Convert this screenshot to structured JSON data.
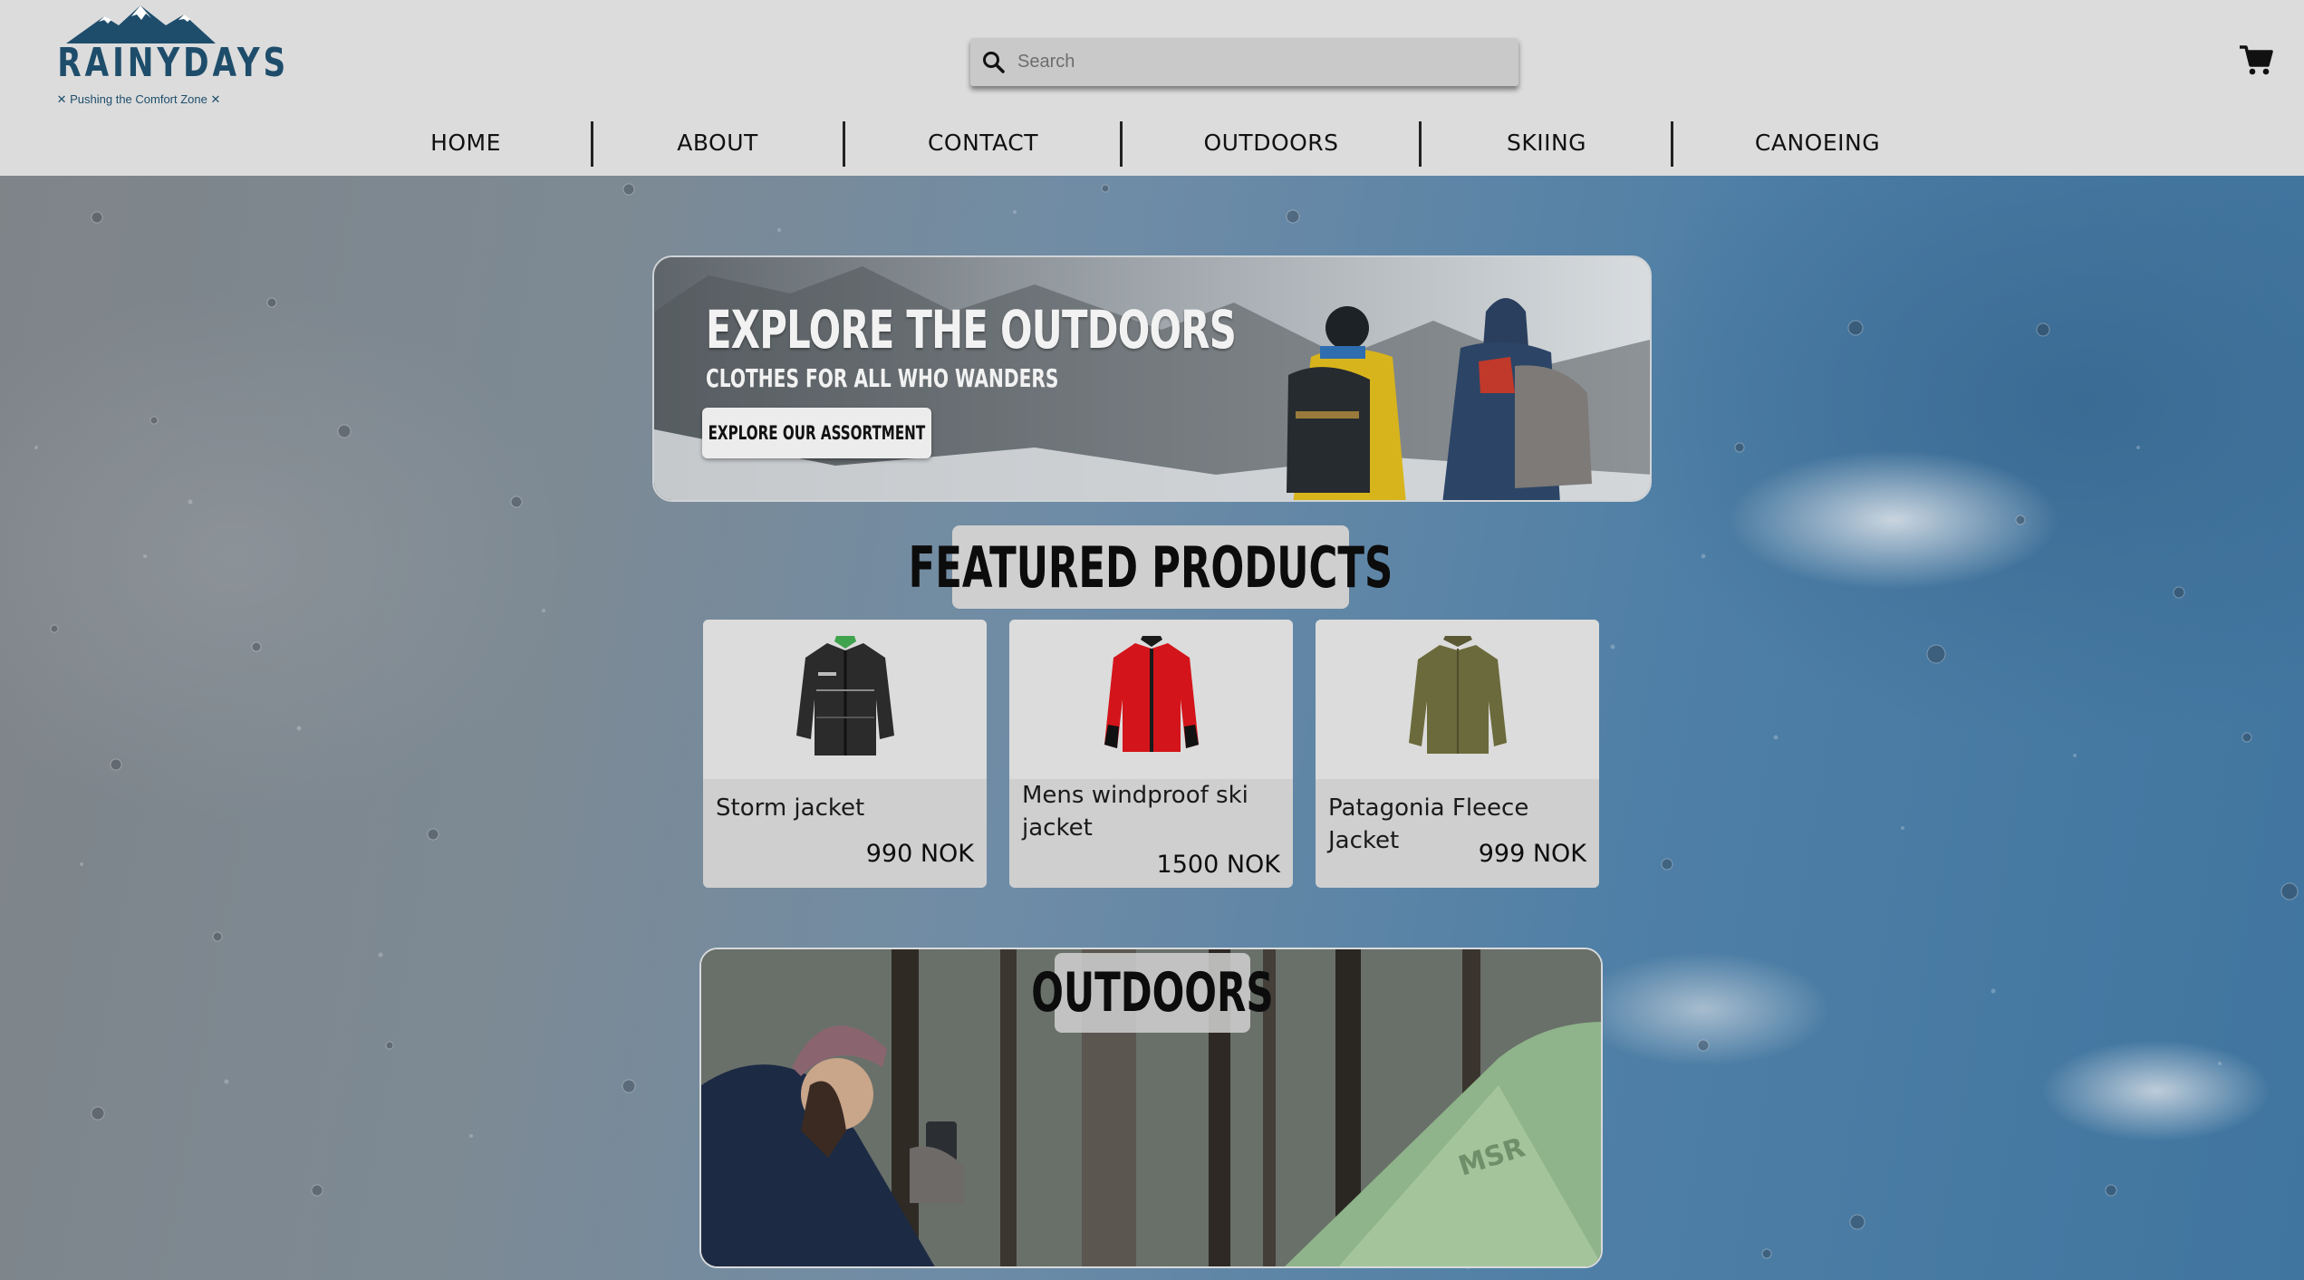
{
  "brand": {
    "name": "RAINYDAYS",
    "tagline": "✕ Pushing the Comfort Zone ✕",
    "color": "#1e4d6b"
  },
  "search": {
    "placeholder": "Search",
    "icon": "search-icon"
  },
  "cart": {
    "icon": "shopping-cart-icon"
  },
  "nav": {
    "items": [
      {
        "label": "HOME"
      },
      {
        "label": "ABOUT"
      },
      {
        "label": "CONTACT"
      },
      {
        "label": "OUTDOORS"
      },
      {
        "label": "SKIING"
      },
      {
        "label": "CANOEING"
      }
    ]
  },
  "hero": {
    "title": "EXPLORE THE OUTDOORS",
    "subtitle": "CLOTHES FOR ALL WHO WANDERS",
    "button_label": "EXPLORE OUR ASSORTMENT"
  },
  "featured": {
    "title": "FEATURED PRODUCTS",
    "products": [
      {
        "name": "Storm jacket",
        "price": "990 NOK",
        "jacket_color": "#2b2b2b",
        "icon": "black-jacket-image"
      },
      {
        "name": "Mens windproof ski jacket",
        "price": "1500 NOK",
        "jacket_color": "#d3141a",
        "icon": "red-jacket-image"
      },
      {
        "name": "Patagonia Fleece Jacket",
        "price": "999 NOK",
        "jacket_color": "#6b6a3c",
        "icon": "olive-fleece-image"
      }
    ]
  },
  "outdoors": {
    "title": "OUTDOORS",
    "tent_logo": "MSR"
  }
}
